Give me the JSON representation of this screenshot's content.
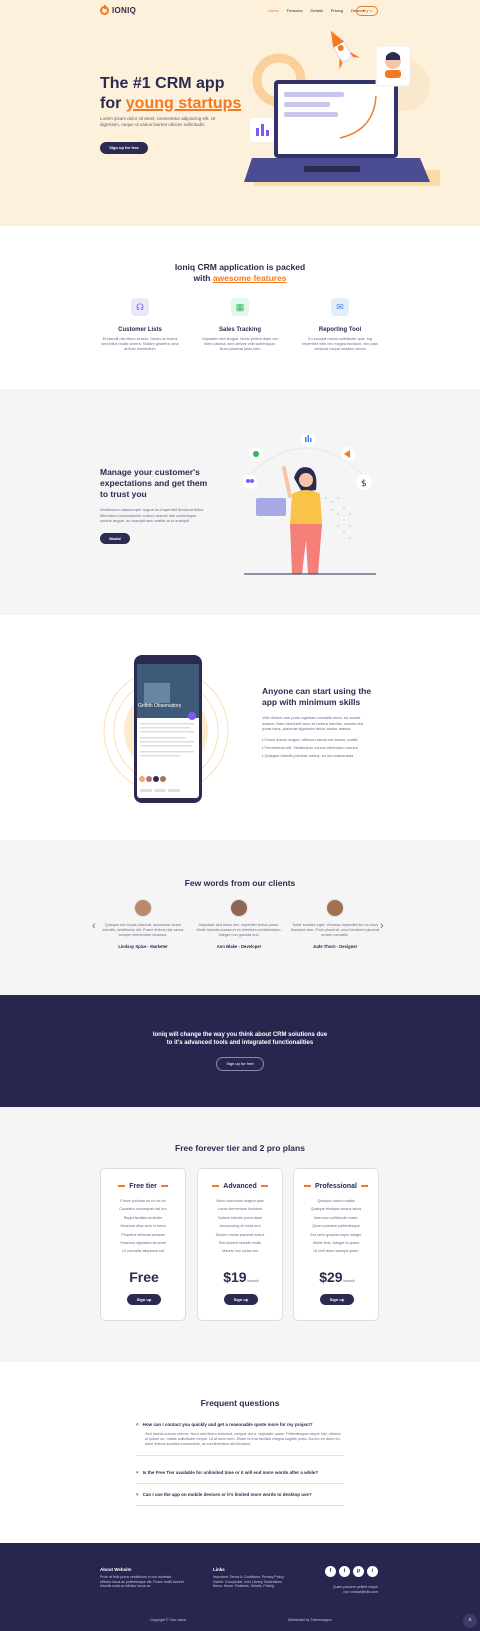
{
  "nav": {
    "brand": "IONIQ",
    "items": [
      "Home",
      "Features",
      "Details",
      "Pricing",
      "Demo ▾"
    ],
    "login": "Log in"
  },
  "hero": {
    "title_line1": "The #1 CRM app",
    "title_line2_prefix": "for ",
    "title_accent": "young startups",
    "text": "Lorem ipsum dolor sit amet, consectetur adipiscing elit. Ut dignissim, neque ut varius laoreet ultrices sollicitudin.",
    "cta": "Sign up for free"
  },
  "features": {
    "title_line1": "Ioniq CRM application is packed",
    "title_prefix": "with ",
    "title_accent": "awesome features",
    "items": [
      {
        "title": "Customer Lists",
        "text": "Et blandit nisl libero at arcu. Donec ac lectus sed tellus mollis viverra. Nullam gharetra urna at ituer elementum",
        "icon": "headphones-icon"
      },
      {
        "title": "Sales Tracking",
        "text": "Vulputate nibh feugiat. Morbi pellent diam nec libero lacinia, sed ultrices velit scelerisque. Nunc placerat justo sem",
        "icon": "clipboard-icon"
      },
      {
        "title": "Reporting Tool",
        "text": "Eu suscipit metus sollicitudin quis. Ing imperdiet nibh nec magna tincidunt, nec pala vehicula neque sodales verum",
        "icon": "chat-icon"
      }
    ]
  },
  "manage": {
    "title": "Manage your customer's expectations and get them to trust you",
    "text": "Vestibulum ullamcorper augue eu imperdiet tincidunt tellus bibendum incunasectur cutrum mauris nibl scelerisque cursus augue, ac suscipit sem mattis at ut suscipit",
    "button": "Modal"
  },
  "skills": {
    "title": "Anyone can start using the app with minimum skills",
    "text": "Velit dictum non proin egestas convallis nunc, eu auctor massa. Nam hendrerit arcu at viverra lobortis, mauris nisi porta risus, placerat dignissim tellus auctor massa",
    "bullets": [
      "Fusce ipsum augue, ultrices rutrum vel auctor, porttit",
      "Fermentum elit. Vestibulum cursus bibendum viverra",
      "Quisque blandit pulvinar metus, eu leo malesuada"
    ],
    "phone_title": "Griffith Observatory"
  },
  "testimonials": {
    "title": "Few words from our clients",
    "items": [
      {
        "quote": "Quisque nec turpis placerat, accumsan lorem lobortis, vestibulum elit. Fusce finibus nisl varius semper elementum vivamus.",
        "name": "Lindsay Spice - Marketer"
      },
      {
        "quote": "Vulputate sed tellus nec, imperdiet lectus purus. Morbi lobortis massa et ex interdum condimentum. Integer non gravida orci.",
        "name": "Ann Blake - Developer"
      },
      {
        "quote": "Tortor sodales eget. Vivamus imperdiet leo eu risus tincidunt sem. Proin placerat, urna hendrerit placerat ornare convallis.",
        "name": "Jude Thorn - Designer"
      }
    ]
  },
  "cta": {
    "text_line1": "Ioniq will change the way you think about CRM solutions due",
    "text_line2": "to it's advanced tools and integrated functionalities",
    "button": "Sign up for free"
  },
  "pricing": {
    "title": "Free forever tier and 2 pro plans",
    "plans": [
      {
        "name": "Free tier",
        "features": [
          "Fusce pulvinar eu mi ac mi",
          "Curabitur consequat nisl bro",
          "Reget facilisis molestie",
          "Vivamus vitae sem in tortor",
          "Pharetra vehicula ornares",
          "Vivamus dignissim sit amet",
          "Ut convallis aliquama set"
        ],
        "price": "Free",
        "per": "",
        "button": "Sign up"
      },
      {
        "name": "Advanced",
        "features": [
          "Nunc commodo magna quis",
          "Lacus fermentum tincidunt",
          "Nullam lobortis porta diam",
          "Announcing of meta mro",
          "Dictum metus placerat luctus",
          "Sed laoreet blandit mollis",
          "Mauris non luctus est"
        ],
        "price": "$19",
        "per": "/month",
        "button": "Sign up"
      },
      {
        "name": "Professional",
        "features": [
          "Quisque rutrum mattis",
          "Quisque tristique cursus lacus",
          "Interdum sollicitudin maec",
          "Quam posuere pellentesque",
          "Est nerci gravida turpis integer",
          "Mollis felis. Integer id quam",
          "Ut velit diam suscipit quam"
        ],
        "price": "$29",
        "per": "/month",
        "button": "Sign up"
      }
    ]
  },
  "faq": {
    "title": "Frequent questions",
    "items": [
      {
        "q": "How can I contact you quickly and get a reasonable quote more for my project?",
        "a": "Sed lacinia cursus viverra. Nunc sed libero euismod, congue dui a, vulputate quam. Pellentesque neque nisi, ultrices ut ipsum ac, mattis sollicitudin neque. Ut at nunc sem. Etiam id erat facilisis magna sagittis porta. Donec eu dolor eu dolor finibus sodales consectetur, at condimentum elit tincidunt"
      },
      {
        "q": "Is the Free Tier available for unlimited time or it will end more words after a while?",
        "a": ""
      },
      {
        "q": "Can I use the app on mobile devices or it's limited more words to desktop use?",
        "a": ""
      }
    ]
  },
  "footer": {
    "about_title": "About Website",
    "about_text": "Proin at fello purus vestibulum in orci molestie, efficitur lacus ac pellentesque elit. Fusce mollit laoreet lobortis nulla ac efficitur lacus ac.",
    "links_title": "Links",
    "links_lines": [
      "Important: Terms & Conditions, Privacy Policy",
      "Useful: Colorpicker, Icon Library, Illustrations",
      "Menu: Home, Features, Details, Pricing"
    ],
    "contact_line1": "Quam posuere pellent neque",
    "contact_line2": "non contact@site.com",
    "social": [
      "f",
      "t",
      "p",
      "i"
    ],
    "copyright": "Copyright © Your name",
    "distributed": "Distributed by Themewagon"
  }
}
